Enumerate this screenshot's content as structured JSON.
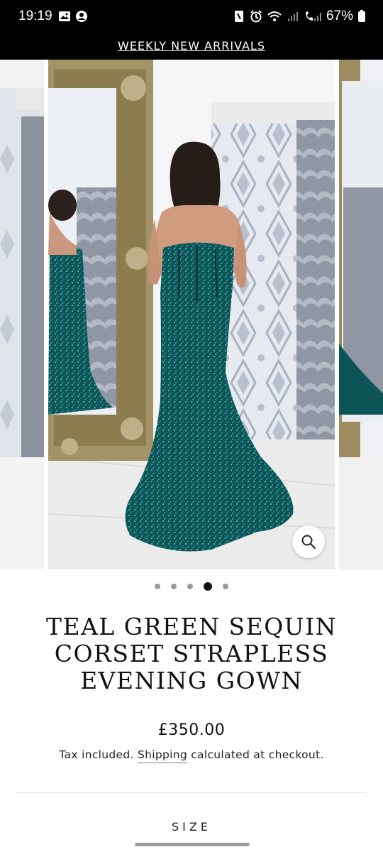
{
  "status_bar": {
    "time": "19:19",
    "battery": "67%",
    "left_icons": [
      "gallery-icon",
      "user-circle-icon"
    ],
    "right_icons": [
      "nfc-icon",
      "alarm-icon",
      "wifi-icon",
      "signal-icon",
      "call-signal-icon",
      "battery-icon"
    ]
  },
  "announcement": {
    "text": "WEEKLY NEW ARRIVALS"
  },
  "gallery": {
    "slide_count": 5,
    "active_index": 3,
    "zoom_icon": "search-icon",
    "colors": {
      "gown": "#0d5a5c",
      "wallpaper": "#d8dde6",
      "mirror_frame": "#9a8a5a"
    }
  },
  "product": {
    "title_lines": [
      "TEAL GREEN SEQUIN",
      "CORSET STRAPLESS",
      "EVENING GOWN"
    ],
    "price": "£350.00",
    "tax_text": "Tax included.",
    "shipping_link": "Shipping",
    "shipping_rest": "calculated at checkout.",
    "size_label": "SIZE"
  }
}
